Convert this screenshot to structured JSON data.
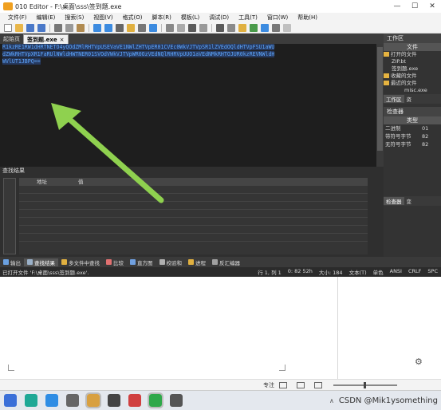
{
  "window": {
    "title": "010 Editor - F:\\桌面\\sss\\签到题.exe"
  },
  "menu": [
    "文件(F)",
    "编辑(E)",
    "搜索(S)",
    "视图(V)",
    "格式(O)",
    "脚本(R)",
    "模板(L)",
    "调试(D)",
    "工具(T)",
    "窗口(W)",
    "帮助(H)"
  ],
  "tabs": {
    "start": "起始页",
    "file": "签到题.exe",
    "close": "×"
  },
  "editor": {
    "lines": [
      "R1kzRE1RW1dHRTNETO4yQOdZMlRHTVpUSEVaVE1NWlZHTVpER01CVEc0WkVJTVpSR1lZVEdOQldHTVpFSU1aWU",
      "dZWkRHTVpXR1FaRUlNWldHWTNER01SVOdVWkVJTVpWR0OzVEdNQlRHRVpUUO1aVEdNMkRHTOJUR0kzREVNWldH",
      "WVlUT1JBPQ=="
    ]
  },
  "right_panel": {
    "workspace_label": "工作区",
    "file_col": "文件",
    "tree": [
      "打开的文件",
      "ZIP.bt",
      "签到题.exe",
      "收藏的文件",
      "最近的文件",
      "misc.exe"
    ],
    "tabs": [
      "工作区",
      "资"
    ],
    "inspector": {
      "title": "检查器",
      "type_col": "类型",
      "rows": [
        {
          "k": "二进制",
          "v": "01"
        },
        {
          "k": "带符号字节",
          "v": "82"
        },
        {
          "k": "无符号字节",
          "v": "82"
        }
      ],
      "tabs": [
        "检查器",
        "变"
      ]
    }
  },
  "find_results": {
    "title": "查找结果",
    "columns": [
      "地址",
      "值"
    ]
  },
  "bottom_tabs": [
    "输出",
    "查找结果",
    "多文件中查找",
    "比较",
    "直方图",
    "校验和",
    "进程",
    "反汇编器"
  ],
  "status": {
    "left": "已打开文件 'F:\\桌面\\sss\\签到题.exe'.",
    "position": "行 1, 列 1",
    "value": "0: 82 52h",
    "size": "大小: 184",
    "items": [
      "文本(T)",
      "单色",
      "ANSI",
      "CRLF",
      "SPC"
    ]
  },
  "word_status": {
    "focus": "专注"
  },
  "watermark": "CSDN @Mik1ysomething",
  "colors": {
    "accent": "#5ea7ff",
    "arrow": "#8fd14f"
  }
}
